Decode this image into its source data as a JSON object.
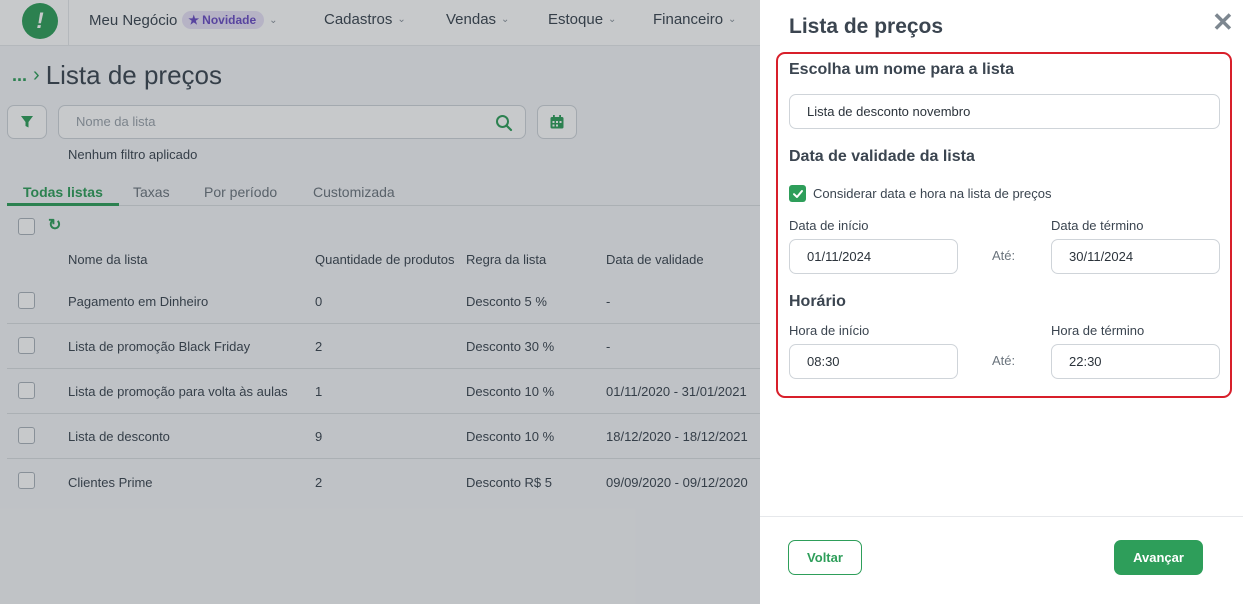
{
  "colors": {
    "accent": "#2e9e5a",
    "highlight_border": "#d81f2a",
    "text": "#3b4550"
  },
  "topbar": {
    "logo_glyph": "!",
    "items": [
      {
        "label": "Meu Negócio",
        "badge": "Novidade"
      },
      {
        "label": "Cadastros"
      },
      {
        "label": "Vendas"
      },
      {
        "label": "Estoque"
      },
      {
        "label": "Financeiro"
      }
    ]
  },
  "breadcrumb": {
    "ellipsis": "...",
    "title": "Lista de preços"
  },
  "search": {
    "placeholder": "Nome da lista",
    "filter_status": "Nenhum filtro aplicado"
  },
  "tabs": [
    "Todas listas",
    "Taxas",
    "Por período",
    "Customizada"
  ],
  "table": {
    "columns": [
      "Nome da lista",
      "Quantidade de produtos",
      "Regra da lista",
      "Data de validade"
    ],
    "rows": [
      [
        "Pagamento em Dinheiro",
        "0",
        "Desconto 5 %",
        "-"
      ],
      [
        "Lista de promoção Black Friday",
        "2",
        "Desconto 30 %",
        "-"
      ],
      [
        "Lista de promoção para volta às aulas",
        "1",
        "Desconto 10 %",
        "01/11/2020 - 31/01/2021"
      ],
      [
        "Lista de desconto",
        "9",
        "Desconto 10 %",
        "18/12/2020 - 18/12/2021"
      ],
      [
        "Clientes Prime",
        "2",
        "Desconto R$ 5",
        "09/09/2020 - 09/12/2020"
      ]
    ]
  },
  "panel": {
    "title": "Lista de preços",
    "name_section": {
      "heading": "Escolha um nome para a lista",
      "value": "Lista de desconto novembro"
    },
    "validity_section": {
      "heading": "Data de validade da lista",
      "checkbox_label": "Considerar data e hora na lista de preços",
      "checkbox_checked": true,
      "start_label": "Data de início",
      "start_value": "01/11/2024",
      "until": "Até:",
      "end_label": "Data de término",
      "end_value": "30/11/2024"
    },
    "time_section": {
      "heading": "Horário",
      "start_label": "Hora de início",
      "start_value": "08:30",
      "until": "Até:",
      "end_label": "Hora de término",
      "end_value": "22:30"
    },
    "footer": {
      "back_label": "Voltar",
      "next_label": "Avançar"
    }
  }
}
